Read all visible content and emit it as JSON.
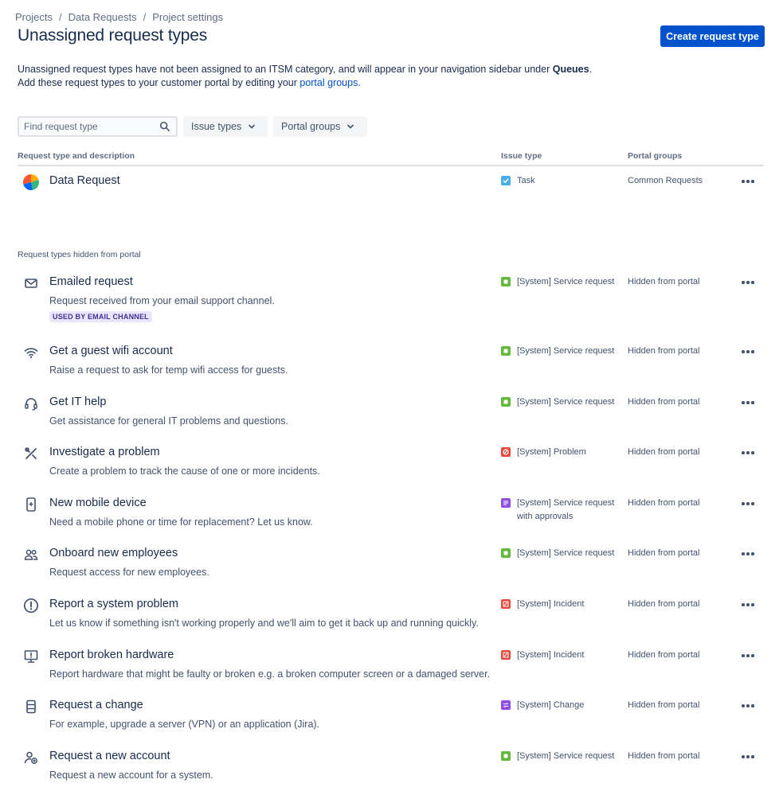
{
  "breadcrumb": [
    "Projects",
    "Data Requests",
    "Project settings"
  ],
  "page": {
    "title": "Unassigned request types",
    "create_label": "Create request type"
  },
  "intro": {
    "line1_a": "Unassigned request types have not been assigned to an ITSM category, and will appear in your navigation sidebar under ",
    "line1_bold": "Queues",
    "line1_b": ".",
    "line2_a": "Add these request types to your customer portal by editing your ",
    "line2_link": "portal groups",
    "line2_b": "."
  },
  "search": {
    "placeholder": "Find request type",
    "value": ""
  },
  "filters": {
    "issue_types": "Issue types",
    "portal_groups": "Portal groups"
  },
  "columns": {
    "request": "Request type and description",
    "issue": "Issue type",
    "portal": "Portal groups"
  },
  "colors": {
    "accent": "#0052cc",
    "service": "#63ba3c",
    "problem": "#e5493a",
    "incident": "#e5493a",
    "approvals": "#904ee2",
    "change": "#904ee2",
    "task": "#4bade8"
  },
  "main_rows": [
    {
      "icon": "pie-chart-icon",
      "title": "Data Request",
      "description": "",
      "issue_icon": "task-icon",
      "issue_type": "Task",
      "portal": "Common Requests"
    }
  ],
  "hidden_label": "Request types hidden from portal",
  "hidden_badge": "USED BY EMAIL CHANNEL",
  "hidden_rows": [
    {
      "icon": "mail-icon",
      "title": "Emailed request",
      "description": "Request received from your email support channel.",
      "issue_icon": "service-icon",
      "issue_type": "[System] Service request",
      "portal": "Hidden from portal"
    },
    {
      "icon": "wifi-icon",
      "title": "Get a guest wifi account",
      "description": "Raise a request to ask for temp wifi access for guests.",
      "issue_icon": "service-icon",
      "issue_type": "[System] Service request",
      "portal": "Hidden from portal"
    },
    {
      "icon": "headset-icon",
      "title": "Get IT help",
      "description": "Get assistance for general IT problems and questions.",
      "issue_icon": "service-icon",
      "issue_type": "[System] Service request",
      "portal": "Hidden from portal"
    },
    {
      "icon": "tools-icon",
      "title": "Investigate a problem",
      "description": "Create a problem to track the cause of one or more incidents.",
      "issue_icon": "problem-icon",
      "issue_type": "[System] Problem",
      "portal": "Hidden from portal"
    },
    {
      "icon": "mobile-icon",
      "title": "New mobile device",
      "description": "Need a mobile phone or time for replacement? Let us know.",
      "issue_icon": "approvals-icon",
      "issue_type": "[System] Service request with approvals",
      "portal": "Hidden from portal"
    },
    {
      "icon": "people-icon",
      "title": "Onboard new employees",
      "description": "Request access for new employees.",
      "issue_icon": "service-icon",
      "issue_type": "[System] Service request",
      "portal": "Hidden from portal"
    },
    {
      "icon": "alert-icon",
      "title": "Report a system problem",
      "description": "Let us know if something isn't working properly and we'll aim to get it back up and running quickly.",
      "issue_icon": "incident-icon",
      "issue_type": "[System] Incident",
      "portal": "Hidden from portal"
    },
    {
      "icon": "monitor-icon",
      "title": "Report broken hardware",
      "description": "Report hardware that might be faulty or broken e.g. a broken computer screen or a damaged server.",
      "issue_icon": "incident-icon",
      "issue_type": "[System] Incident",
      "portal": "Hidden from portal"
    },
    {
      "icon": "server-icon",
      "title": "Request a change",
      "description": "For example, upgrade a server (VPN) or an application (Jira).",
      "issue_icon": "change-icon",
      "issue_type": "[System] Change",
      "portal": "Hidden from portal"
    },
    {
      "icon": "add-user-icon",
      "title": "Request a new account",
      "description": "Request a new account for a system.",
      "issue_icon": "service-icon",
      "issue_type": "[System] Service request",
      "portal": "Hidden from portal"
    }
  ]
}
